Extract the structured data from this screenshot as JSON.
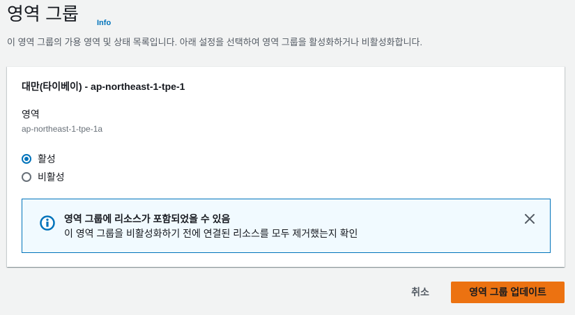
{
  "page": {
    "title": "영역 그룹",
    "info_link": "Info",
    "description": "이 영역 그룹의 가용 영역 및 상태 목록입니다. 아래 설정을 선택하여 영역 그룹을 활성화하거나 비활성화합니다."
  },
  "zone_group": {
    "title": "대만(타이베이) - ap-northeast-1-tpe-1",
    "zone_label": "영역",
    "zone_value": "ap-northeast-1-tpe-1a",
    "status_options": [
      {
        "label": "활성",
        "selected": true
      },
      {
        "label": "비활성",
        "selected": false
      }
    ],
    "alert": {
      "type": "info",
      "icon": "info-icon",
      "title": "영역 그룹에 리소스가 포함되었을 수 있음",
      "message": "이 영역 그룹을 비활성화하기 전에 연결된 리소스를 모두 제거했는지 확인",
      "dismiss_icon": "close-icon"
    }
  },
  "actions": {
    "cancel_label": "취소",
    "submit_label": "영역 그룹 업데이트"
  },
  "colors": {
    "background": "#f2f3f3",
    "link": "#0073bb",
    "primary": "#ec7211",
    "alert_bg": "#f1faff",
    "alert_border": "#0073bb"
  }
}
